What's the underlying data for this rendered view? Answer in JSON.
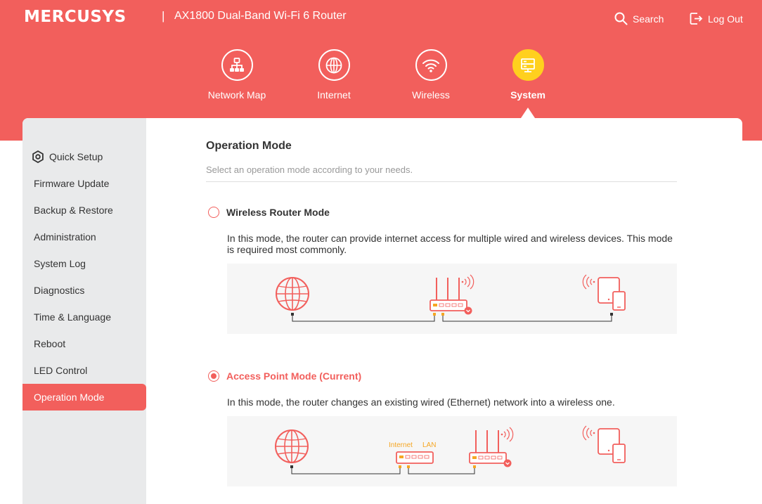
{
  "header": {
    "logo": "MERCUSYS",
    "separator": "|",
    "model": "AX1800 Dual-Band Wi-Fi 6 Router",
    "search_label": "Search",
    "logout_label": "Log Out"
  },
  "nav": {
    "tabs": [
      {
        "label": "Network Map",
        "icon": "network-map-icon"
      },
      {
        "label": "Internet",
        "icon": "globe-icon"
      },
      {
        "label": "Wireless",
        "icon": "wifi-icon"
      },
      {
        "label": "System",
        "icon": "system-icon"
      }
    ],
    "active": "System"
  },
  "sidebar": {
    "items": [
      {
        "label": "Quick Setup",
        "icon": "gear-icon"
      },
      {
        "label": "Firmware Update"
      },
      {
        "label": "Backup & Restore"
      },
      {
        "label": "Administration"
      },
      {
        "label": "System Log"
      },
      {
        "label": "Diagnostics"
      },
      {
        "label": "Time & Language"
      },
      {
        "label": "Reboot"
      },
      {
        "label": "LED Control"
      },
      {
        "label": "Operation Mode"
      }
    ],
    "active": "Operation Mode"
  },
  "page": {
    "title": "Operation Mode",
    "subtitle": "Select an operation mode according to your needs."
  },
  "modes": [
    {
      "label": "Wireless Router Mode",
      "selected": false,
      "description": "In this mode, the router can provide internet access for multiple wired and wireless devices. This mode is required most commonly."
    },
    {
      "label": "Access Point Mode (Current)",
      "selected": true,
      "description": "In this mode, the router changes an existing wired (Ethernet) network into a wireless one.",
      "diagram_labels": {
        "internet": "Internet",
        "lan": "LAN"
      }
    }
  ],
  "colors": {
    "brand": "#f25f5c",
    "active_nav": "#ffd01e",
    "port_highlight": "#f5a623",
    "sidebar_bg": "#e9eaeb"
  }
}
